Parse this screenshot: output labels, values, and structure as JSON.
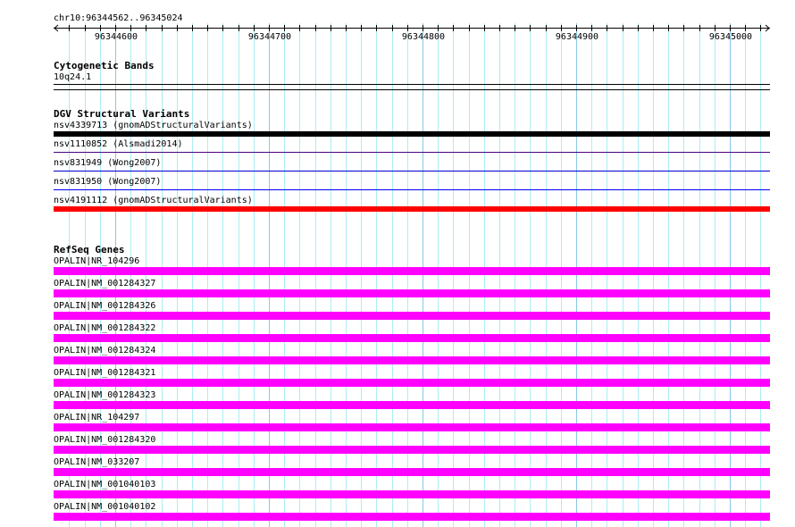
{
  "ruler": {
    "region": "chr10:96344562..96345024",
    "start": 96344562,
    "end": 96345024,
    "ticks": [
      "96344600",
      "96344700",
      "96344800",
      "96344900",
      "96345000"
    ]
  },
  "tracks": {
    "cytoband": {
      "title": "Cytogenetic Bands",
      "label": "10q24.1"
    },
    "dgv": {
      "title": "DGV Structural Variants",
      "items": [
        {
          "label": "nsv4339713 (gnomADStructuralVariants)",
          "color": "#000000",
          "style": "thick"
        },
        {
          "label": "nsv1110852 (Alsmadi2014)",
          "color": "#4b0082",
          "style": "thin"
        },
        {
          "label": "nsv831949 (Wong2007)",
          "color": "#0000cc",
          "style": "thin"
        },
        {
          "label": "nsv831950 (Wong2007)",
          "color": "#0000ff",
          "style": "thin"
        },
        {
          "label": "nsv4191112 (gnomADStructuralVariants)",
          "color": "#ff0000",
          "style": "thick"
        }
      ]
    },
    "refseq": {
      "title": "RefSeq Genes",
      "color": "#ff00ff",
      "items": [
        "OPALIN|NR_104296",
        "OPALIN|NM_001284327",
        "OPALIN|NM_001284326",
        "OPALIN|NM_001284322",
        "OPALIN|NM_001284324",
        "OPALIN|NM_001284321",
        "OPALIN|NM_001284323",
        "OPALIN|NR_104297",
        "OPALIN|NM_001284320",
        "OPALIN|NM_033207",
        "OPALIN|NM_001040103",
        "OPALIN|NM_001040102"
      ]
    }
  }
}
